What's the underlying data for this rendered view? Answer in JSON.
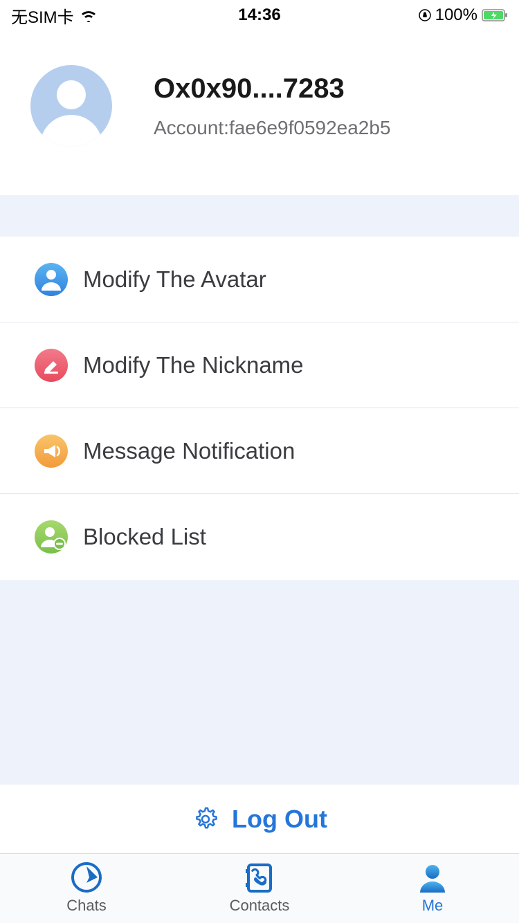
{
  "status_bar": {
    "carrier": "无SIM卡",
    "time": "14:36",
    "battery_pct": "100%"
  },
  "profile": {
    "display_name": "Ox0x90....7283",
    "account_prefix": "Account:",
    "account_value": "fae6e9f0592ea2b5"
  },
  "menu": {
    "items": [
      {
        "label": "Modify The Avatar"
      },
      {
        "label": "Modify The Nickname"
      },
      {
        "label": "Message Notification"
      },
      {
        "label": "Blocked List"
      }
    ]
  },
  "logout_label": "Log Out",
  "tabs": {
    "chats": "Chats",
    "contacts": "Contacts",
    "me": "Me"
  }
}
